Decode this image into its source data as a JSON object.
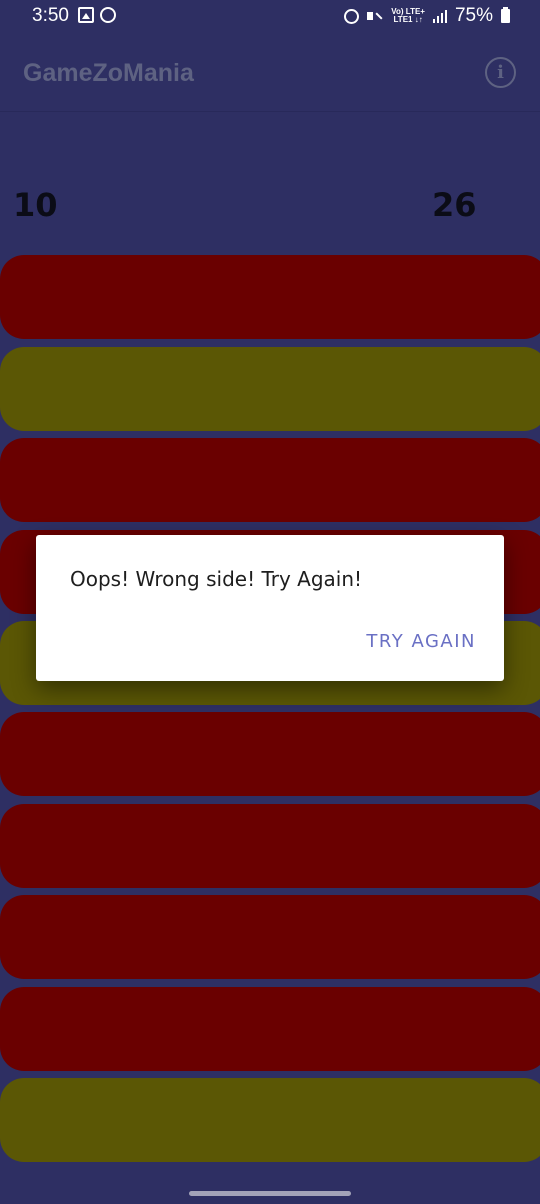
{
  "status_bar": {
    "time": "3:50",
    "network_top": "Vo) LTE+",
    "network_bottom": "LTE1 ↓↑",
    "battery": "75%",
    "icons": [
      "image-icon",
      "whatsapp-icon",
      "alarm-icon",
      "mute-icon",
      "signal-icon",
      "battery-icon"
    ]
  },
  "app_bar": {
    "title": "GameZoMania",
    "info_icon": "i"
  },
  "scores": {
    "left": "10",
    "right": "26"
  },
  "bars": [
    {
      "color": "#6a0000"
    },
    {
      "color": "#5b5705"
    },
    {
      "color": "#6a0000"
    },
    {
      "color": "#6a0000"
    },
    {
      "color": "#5b5705"
    },
    {
      "color": "#6a0000"
    },
    {
      "color": "#6a0000"
    },
    {
      "color": "#6a0000"
    },
    {
      "color": "#6a0000"
    },
    {
      "color": "#5b5705"
    }
  ],
  "dialog": {
    "message": "Oops! Wrong side! Try Again!",
    "button": "TRY AGAIN"
  },
  "colors": {
    "background": "#2e2f63",
    "red_bar": "#6a0000",
    "olive_bar": "#5b5705",
    "accent": "#6a70c4"
  }
}
